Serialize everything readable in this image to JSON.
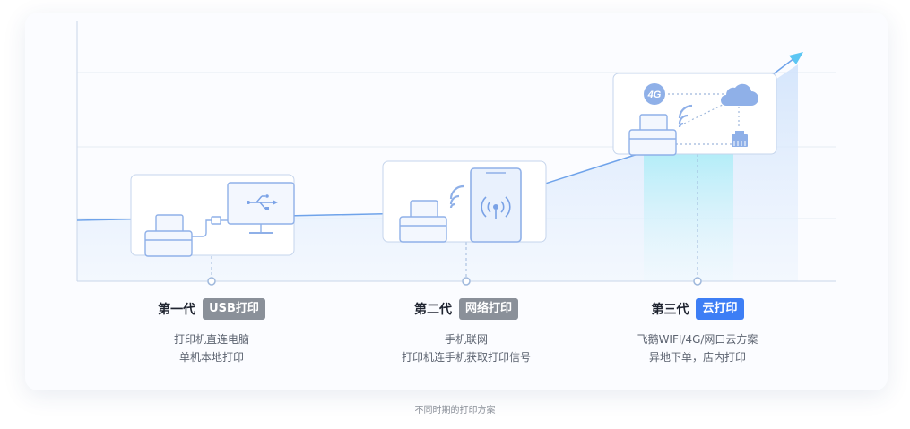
{
  "generations": [
    {
      "label": "第一代",
      "badge": "USB打印",
      "badge_color": "#8a9099",
      "desc": [
        "打印机直连电脑",
        "单机本地打印"
      ]
    },
    {
      "label": "第二代",
      "badge": "网络打印",
      "badge_color": "#8a9099",
      "desc": [
        "手机联网",
        "打印机连手机获取打印信号"
      ]
    },
    {
      "label": "第三代",
      "badge": "云打印",
      "badge_color": "#3d7ef5",
      "desc": [
        "飞鹅WIFI/4G/网口云方案",
        "异地下单，店内打印"
      ]
    }
  ],
  "network_badge": "4G",
  "caption": "不同时期的打印方案",
  "colors": {
    "accent": "#3d7ef5",
    "line": "#6fa3ea",
    "arrow": "#5cc6f3",
    "icon": "#8fb0e8"
  }
}
